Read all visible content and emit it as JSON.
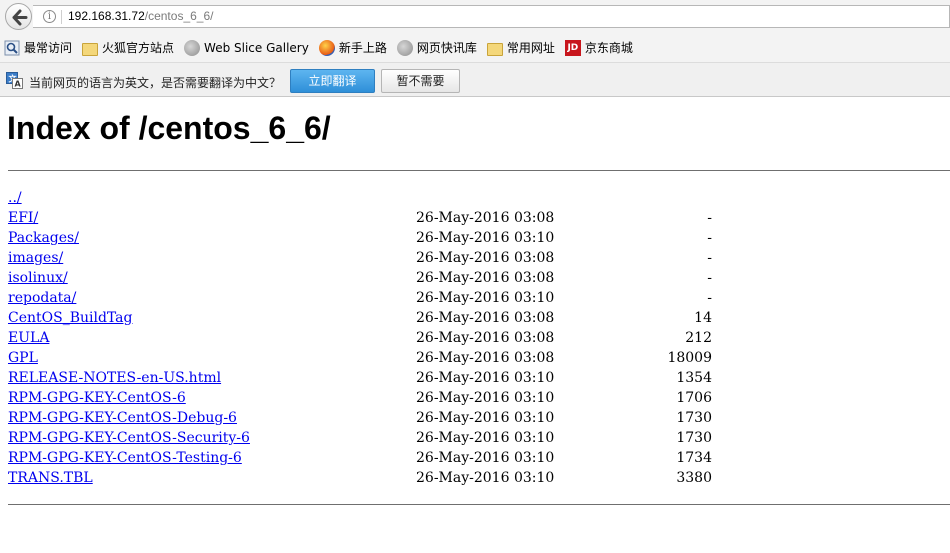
{
  "browser": {
    "url_host": "192.168.31.72",
    "url_path": "/centos_6_6/",
    "bookmarks": [
      {
        "label": "最常访问",
        "icon": "magnifier-icon"
      },
      {
        "label": "火狐官方站点",
        "icon": "folder-icon"
      },
      {
        "label": "Web Slice Gallery",
        "icon": "globe-icon"
      },
      {
        "label": "新手上路",
        "icon": "firefox-icon"
      },
      {
        "label": "网页快讯库",
        "icon": "globe-icon"
      },
      {
        "label": "常用网址",
        "icon": "folder-icon"
      },
      {
        "label": "京东商城",
        "icon": "jd-icon",
        "icon_text": "JD"
      }
    ]
  },
  "translate_bar": {
    "message": "当前网页的语言为英文，是否需要翻译为中文？",
    "translate_label": "立即翻译",
    "dismiss_label": "暂不需要"
  },
  "page": {
    "title": "Index of /centos_6_6/",
    "entries": [
      {
        "name": "../",
        "date": "",
        "size": ""
      },
      {
        "name": "EFI/",
        "date": "26-May-2016 03:08",
        "size": "-"
      },
      {
        "name": "Packages/",
        "date": "26-May-2016 03:10",
        "size": "-"
      },
      {
        "name": "images/",
        "date": "26-May-2016 03:08",
        "size": "-"
      },
      {
        "name": "isolinux/",
        "date": "26-May-2016 03:08",
        "size": "-"
      },
      {
        "name": "repodata/",
        "date": "26-May-2016 03:10",
        "size": "-"
      },
      {
        "name": "CentOS_BuildTag",
        "date": "26-May-2016 03:08",
        "size": "14"
      },
      {
        "name": "EULA",
        "date": "26-May-2016 03:08",
        "size": "212"
      },
      {
        "name": "GPL",
        "date": "26-May-2016 03:08",
        "size": "18009"
      },
      {
        "name": "RELEASE-NOTES-en-US.html",
        "date": "26-May-2016 03:10",
        "size": "1354"
      },
      {
        "name": "RPM-GPG-KEY-CentOS-6",
        "date": "26-May-2016 03:10",
        "size": "1706"
      },
      {
        "name": "RPM-GPG-KEY-CentOS-Debug-6",
        "date": "26-May-2016 03:10",
        "size": "1730"
      },
      {
        "name": "RPM-GPG-KEY-CentOS-Security-6",
        "date": "26-May-2016 03:10",
        "size": "1730"
      },
      {
        "name": "RPM-GPG-KEY-CentOS-Testing-6",
        "date": "26-May-2016 03:10",
        "size": "1734"
      },
      {
        "name": "TRANS.TBL",
        "date": "26-May-2016 03:10",
        "size": "3380"
      }
    ]
  }
}
